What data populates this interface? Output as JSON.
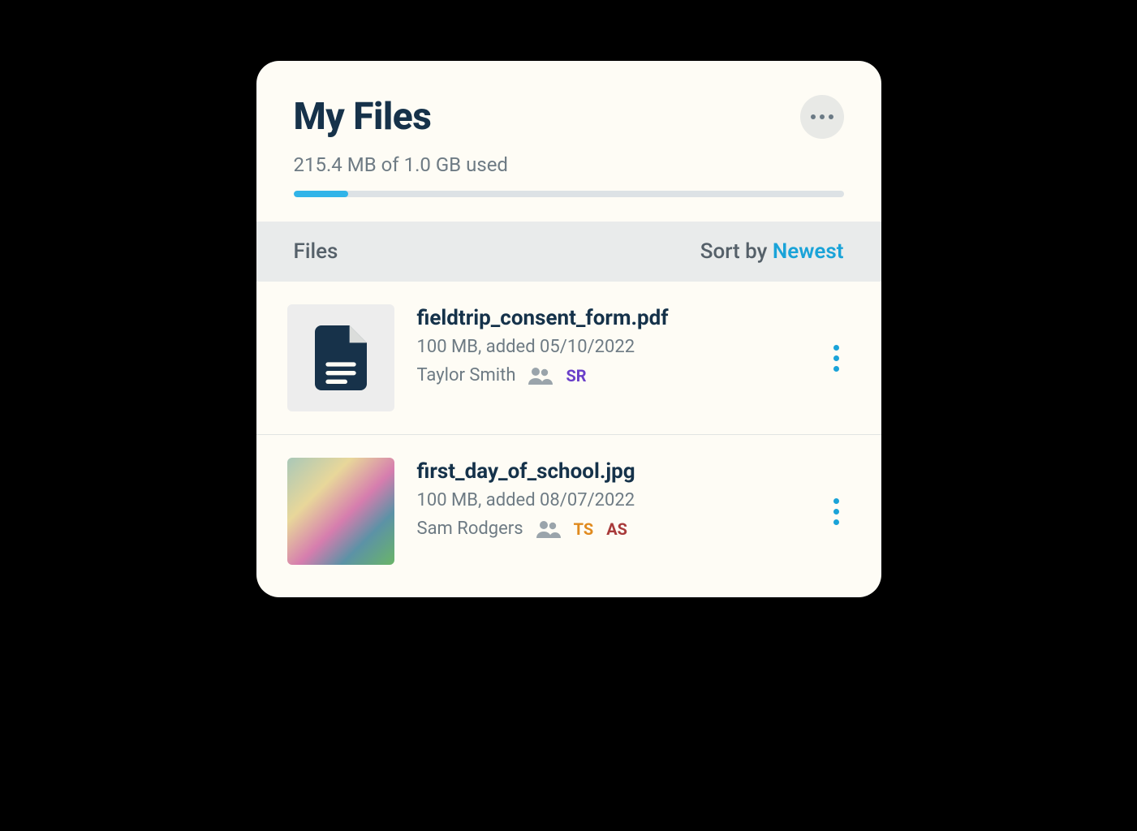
{
  "header": {
    "title": "My Files"
  },
  "storage": {
    "text": "215.4 MB of 1.0 GB used",
    "percent": 10
  },
  "list": {
    "header_label": "Files",
    "sort_label": "Sort by ",
    "sort_value": "Newest"
  },
  "files": [
    {
      "name": "fieldtrip_consent_form.pdf",
      "meta": "100 MB, added  05/10/2022",
      "owner": "Taylor Smith",
      "shared": [
        {
          "initials": "SR",
          "color": "#6A3FC9"
        }
      ],
      "thumb_type": "doc"
    },
    {
      "name": "first_day_of_school.jpg",
      "meta": "100 MB, added 08/07/2022",
      "owner": "Sam Rodgers",
      "shared": [
        {
          "initials": "TS",
          "color": "#E08A1E"
        },
        {
          "initials": "AS",
          "color": "#A83A3A"
        }
      ],
      "thumb_type": "image"
    }
  ]
}
